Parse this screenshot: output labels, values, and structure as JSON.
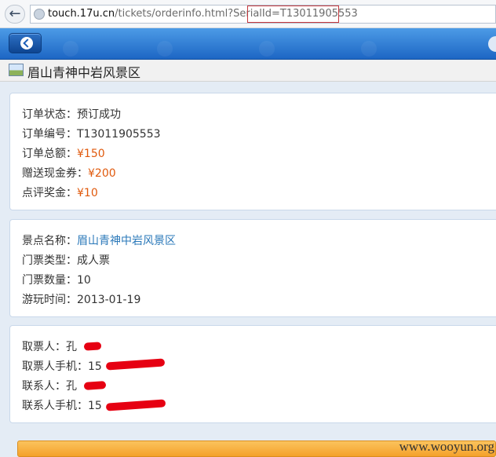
{
  "browser": {
    "url_host": "touch.17u.cn",
    "url_path_prefix": "/tickets/orderinfo.html?SerialId=",
    "url_serial": "T13011905553"
  },
  "page": {
    "title": "眉山青神中岩风景区"
  },
  "order": {
    "status_label": "订单状态：",
    "status_value": "预订成功",
    "number_label": "订单编号：",
    "number_value": "T13011905553",
    "total_label": "订单总额：",
    "total_value": "¥150",
    "cash_voucher_label": "赠送现金券：",
    "cash_voucher_value": "¥200",
    "review_bonus_label": "点评奖金：",
    "review_bonus_value": "¥10"
  },
  "ticket": {
    "scenic_label": "景点名称：",
    "scenic_value": "眉山青神中岩风景区",
    "type_label": "门票类型：",
    "type_value": "成人票",
    "qty_label": "门票数量：",
    "qty_value": "10",
    "date_label": "游玩时间：",
    "date_value": "2013-01-19"
  },
  "contact": {
    "taker_label": "取票人：",
    "taker_value": "孔",
    "taker_phone_label": "取票人手机：",
    "taker_phone_value": "15",
    "contact_label": "联系人：",
    "contact_value": "孔",
    "contact_phone_label": "联系人手机：",
    "contact_phone_value": "15"
  },
  "watermark": "www.wooyun.org",
  "colors": {
    "header": "#1d66c4",
    "price": "#e0590c",
    "link": "#2a78b9",
    "highlight_box": "#c4373d",
    "redaction": "#e60012"
  }
}
